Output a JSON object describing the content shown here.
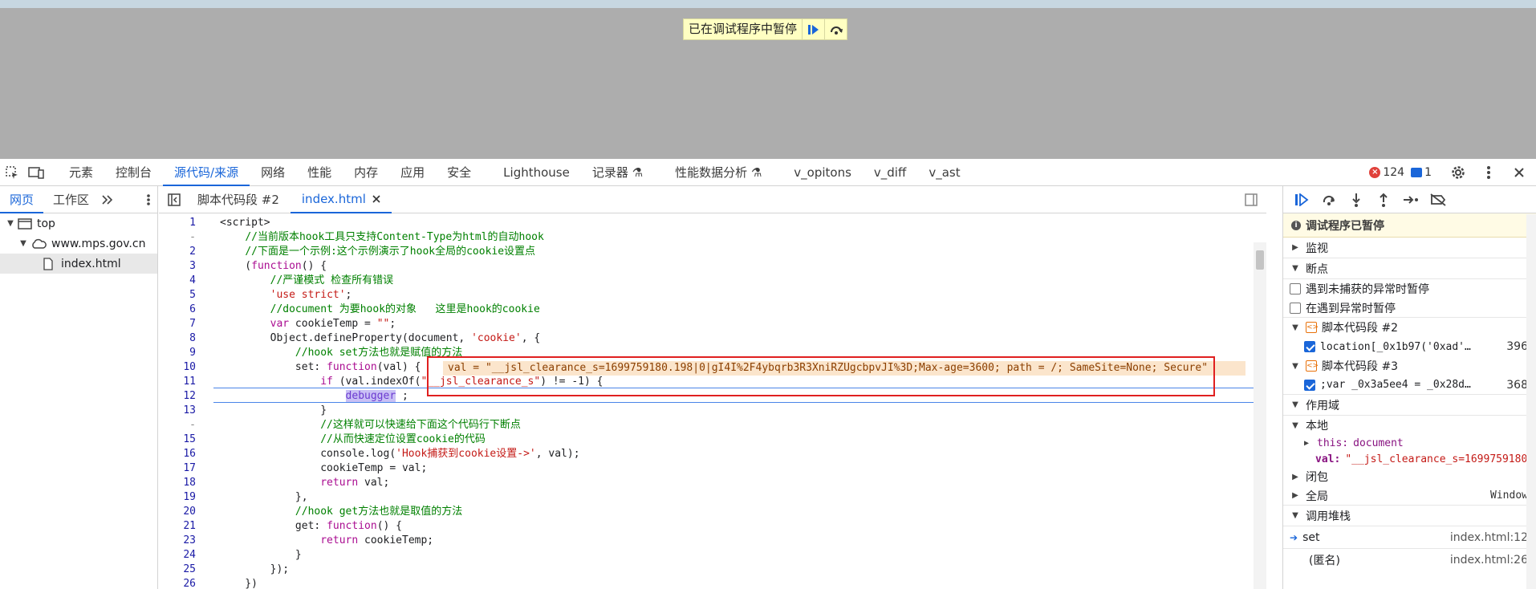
{
  "page": {
    "paused_banner": "已在调试程序中暂停"
  },
  "main_tabs": [
    {
      "label": "元素"
    },
    {
      "label": "控制台"
    },
    {
      "label": "源代码/来源"
    },
    {
      "label": "网络"
    },
    {
      "label": "性能"
    },
    {
      "label": "内存"
    },
    {
      "label": "应用"
    },
    {
      "label": "安全"
    },
    {
      "label": "Lighthouse"
    },
    {
      "label": "记录器 ⚗"
    },
    {
      "label": "性能数据分析 ⚗"
    },
    {
      "label": "v_opitons"
    },
    {
      "label": "v_diff"
    },
    {
      "label": "v_ast"
    }
  ],
  "indicators": {
    "errors": "124",
    "messages": "1"
  },
  "navigator": {
    "tabs": [
      "网页",
      "工作区"
    ],
    "tree": {
      "top": "top",
      "domain": "www.mps.gov.cn",
      "file": "index.html"
    }
  },
  "editor": {
    "tabs": [
      "脚本代码段 #2",
      "index.html"
    ],
    "inline_value": "val = \"__jsl_clearance_s=1699759180.198|0|gI4I%2F4ybqrb3R3XniRZUgcbpvJI%3D;Max-age=3600; path = /; SameSite=None; Secure\"",
    "lines": [
      {
        "n": "1",
        "html": "<script>"
      },
      {
        "n": "-",
        "html": "    <span class=\"cmt\">//当前版本hook工具只支持Content-Type为html的自动hook</span>"
      },
      {
        "n": "2",
        "html": "    <span class=\"cmt\">//下面是一个示例:这个示例演示了hook全局的cookie设置点</span>"
      },
      {
        "n": "3",
        "html": "    (<span class=\"kw\">function</span>() {"
      },
      {
        "n": "4",
        "html": "        <span class=\"cmt\">//严谨模式 检查所有错误</span>"
      },
      {
        "n": "5",
        "html": "        <span class=\"str\">'use strict'</span>;"
      },
      {
        "n": "6",
        "html": "        <span class=\"cmt\">//document 为要hook的对象   这里是hook的cookie</span>"
      },
      {
        "n": "7",
        "html": "        <span class=\"kw\">var</span> cookieTemp = <span class=\"str\">\"\"</span>;"
      },
      {
        "n": "8",
        "html": "        Object.defineProperty(document, <span class=\"str\">'cookie'</span>, {"
      },
      {
        "n": "9",
        "html": "            <span class=\"cmt\">//hook set方法也就是赋值的方法</span>"
      },
      {
        "n": "10",
        "html": "            set: <span class=\"kw\">function</span>(val) {"
      },
      {
        "n": "11",
        "html": "                <span class=\"kw\">if</span> (val.indexOf(<span class=\"str\">\"__jsl_clearance_s\"</span>) != -1) {"
      },
      {
        "n": "12",
        "html": "                    <span class=\"sel\">debugger</span> ;"
      },
      {
        "n": "13",
        "html": "                }"
      },
      {
        "n": "-",
        "html": "                <span class=\"cmt\">//这样就可以快速给下面这个代码行下断点</span>"
      },
      {
        "n": "15",
        "html": "                <span class=\"cmt\">//从而快速定位设置cookie的代码</span>"
      },
      {
        "n": "16",
        "html": "                console.log(<span class=\"str\">'Hook捕获到cookie设置->'</span>, val);"
      },
      {
        "n": "17",
        "html": "                cookieTemp = val;"
      },
      {
        "n": "18",
        "html": "                <span class=\"kw\">return</span> val;"
      },
      {
        "n": "19",
        "html": "            },"
      },
      {
        "n": "20",
        "html": "            <span class=\"cmt\">//hook get方法也就是取值的方法</span>"
      },
      {
        "n": "21",
        "html": "            get: <span class=\"kw\">function</span>() {"
      },
      {
        "n": "23",
        "html": "                <span class=\"kw\">return</span> cookieTemp;"
      },
      {
        "n": "24",
        "html": "            }"
      },
      {
        "n": "25",
        "html": "        });"
      },
      {
        "n": "26",
        "html": "    })"
      }
    ]
  },
  "debugger": {
    "paused_msg": "调试程序已暂停",
    "watch": "监视",
    "breakpoints": "断点",
    "pause_uncaught": "遇到未捕获的异常时暂停",
    "pause_caught": "在遇到异常时暂停",
    "bp_groups": [
      {
        "name": "脚本代码段 #2",
        "code": "location[_0x1b97('0xad'…",
        "line": "396"
      },
      {
        "name": "脚本代码段 #3",
        "code": ";var _0x3a5ee4 = _0x28d…",
        "line": "368"
      }
    ],
    "scope": "作用域",
    "local": "本地",
    "this_label": "this:",
    "this_val": "document",
    "val_label": "val:",
    "val_val": "\"__jsl_clearance_s=1699759180",
    "closure": "闭包",
    "global": "全局",
    "global_val": "Window",
    "callstack": "调用堆栈",
    "frames": [
      {
        "name": "set",
        "loc": "index.html:12"
      },
      {
        "name": "(匿名)",
        "loc": "index.html:26"
      }
    ]
  }
}
